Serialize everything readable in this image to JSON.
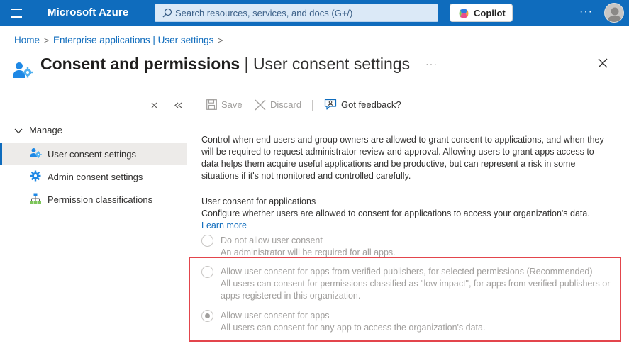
{
  "topbar": {
    "brand": "Microsoft Azure",
    "search_placeholder": "Search resources, services, and docs (G+/)",
    "copilot_label": "Copilot",
    "more_label": "···"
  },
  "breadcrumb": {
    "items": [
      "Home",
      "Enterprise applications | User settings"
    ],
    "separator": ">"
  },
  "header": {
    "title": "Consent and permissions",
    "divider": " | ",
    "subtitle": "User consent settings",
    "more_label": "···"
  },
  "nav": {
    "group_label": "Manage",
    "items": [
      {
        "label": "User consent settings",
        "icon": "consent-gear-icon",
        "selected": true
      },
      {
        "label": "Admin consent settings",
        "icon": "gear-icon",
        "selected": false
      },
      {
        "label": "Permission classifications",
        "icon": "hierarchy-icon",
        "selected": false
      }
    ]
  },
  "toolbar": {
    "save_label": "Save",
    "discard_label": "Discard",
    "feedback_label": "Got feedback?"
  },
  "content": {
    "description": "Control when end users and group owners are allowed to grant consent to applications, and when they will be required to request administrator review and approval. Allowing users to grant apps access to data helps them acquire useful applications and be productive, but can represent a risk in some situations if it's not monitored and controlled carefully.",
    "section_title": "User consent for applications",
    "section_desc": "Configure whether users are allowed to consent for applications to access your organization's data.",
    "learn_more": "Learn more",
    "options": [
      {
        "label": "Do not allow user consent",
        "sub": "An administrator will be required for all apps.",
        "checked": false
      },
      {
        "label": "Allow user consent for apps from verified publishers, for selected permissions (Recommended)",
        "sub": "All users can consent for permissions classified as \"low impact\", for apps from verified publishers or apps registered in this organization.",
        "checked": false
      },
      {
        "label": "Allow user consent for apps",
        "sub": "All users can consent for any app to access the organization's data.",
        "checked": true
      }
    ]
  },
  "colors": {
    "accent": "#0f6cbd",
    "highlight": "#e3454c",
    "disabled_text": "#a19f9d"
  }
}
